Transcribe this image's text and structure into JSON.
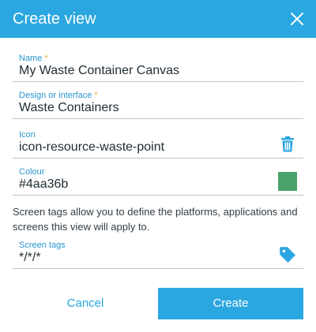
{
  "dialog": {
    "title": "Create view"
  },
  "fields": {
    "name": {
      "label": "Name",
      "required_mark": "*",
      "value": "My Waste Container Canvas"
    },
    "design": {
      "label": "Design or interface",
      "required_mark": "*",
      "value": "Waste Containers"
    },
    "icon": {
      "label": "Icon",
      "value": "icon-resource-waste-point",
      "action_icon": "trash-icon"
    },
    "colour": {
      "label": "Colour",
      "value": "#4aa36b",
      "swatch_color": "#4aa36b"
    },
    "screen_tags": {
      "label": "Screen tags",
      "value": "*/*/*",
      "action_icon": "tag-icon"
    }
  },
  "help_text": "Screen tags allow you to define the platforms, applications and screens this view will apply to.",
  "buttons": {
    "cancel": "Cancel",
    "create": "Create"
  },
  "colors": {
    "header": "#2aa6e0",
    "accent": "#2aa6e0",
    "label": "#2a95cf",
    "required": "#f2a72b"
  }
}
